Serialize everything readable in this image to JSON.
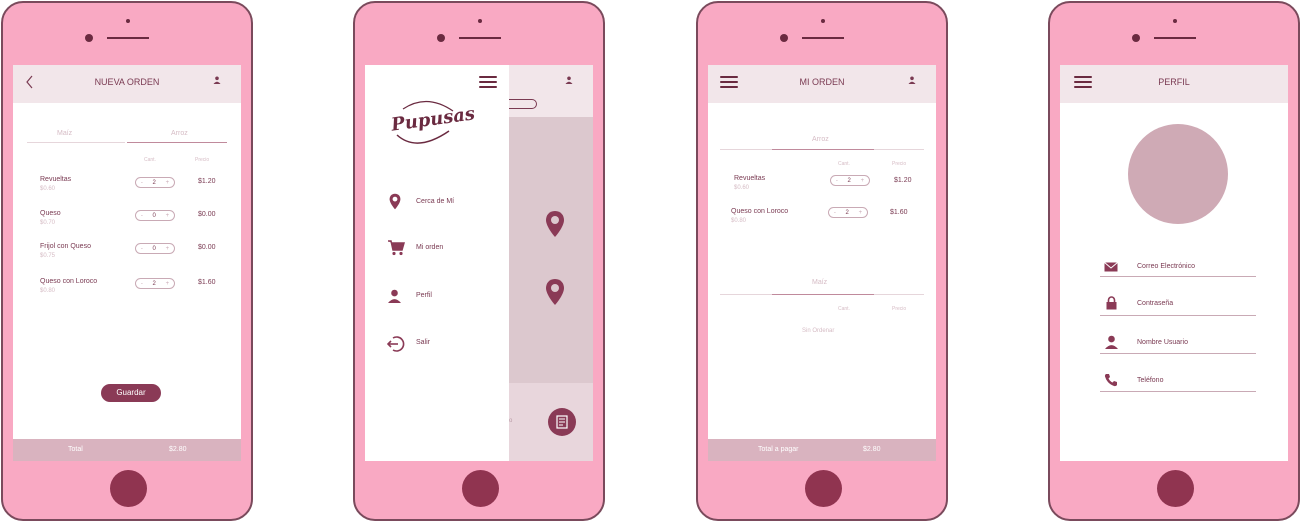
{
  "phone1": {
    "title": "NUEVA ORDEN",
    "tabs": [
      "Maíz",
      "Arroz"
    ],
    "col_cant": "Cant.",
    "col_precio": "Precio",
    "items": [
      {
        "name": "Revueltas",
        "unit": "$0.60",
        "qty": "2",
        "total": "$1.20"
      },
      {
        "name": "Queso",
        "unit": "$0.70",
        "qty": "0",
        "total": "$0.00"
      },
      {
        "name": "Frijol con Queso",
        "unit": "$0.75",
        "qty": "0",
        "total": "$0.00"
      },
      {
        "name": "Queso con Loroco",
        "unit": "$0.80",
        "qty": "2",
        "total": "$1.60"
      }
    ],
    "save_label": "Guardar",
    "total_label": "Total",
    "total_value": "$2.80"
  },
  "phone2": {
    "logo": "Pupusas",
    "menu": [
      "Cerca de Mí",
      "Mi orden",
      "Perfil",
      "Salir"
    ],
    "partial_text": "o"
  },
  "phone3": {
    "title": "MI ORDEN",
    "section1": "Arroz",
    "col_cant": "Cant.",
    "col_precio": "Precio",
    "items": [
      {
        "name": "Revueltas",
        "unit": "$0.60",
        "qty": "2",
        "total": "$1.20"
      },
      {
        "name": "Queso con Loroco",
        "unit": "$0.80",
        "qty": "2",
        "total": "$1.60"
      }
    ],
    "section2": "Maíz",
    "col_cant2": "Cant.",
    "col_precio2": "Precio",
    "empty": "Sin Ordenar",
    "total_label": "Total a pagar",
    "total_value": "$2.80"
  },
  "phone4": {
    "title": "PERFIL",
    "fields": [
      "Correo Electrónico",
      "Contraseña",
      "Nombre Usuario",
      "Teléfono"
    ]
  },
  "colors": {
    "phone_body": "#f9a9c3",
    "accent": "#903450",
    "bar": "#f2e6ea",
    "footer": "#d9b3bf",
    "avatar": "#cfaab5"
  }
}
